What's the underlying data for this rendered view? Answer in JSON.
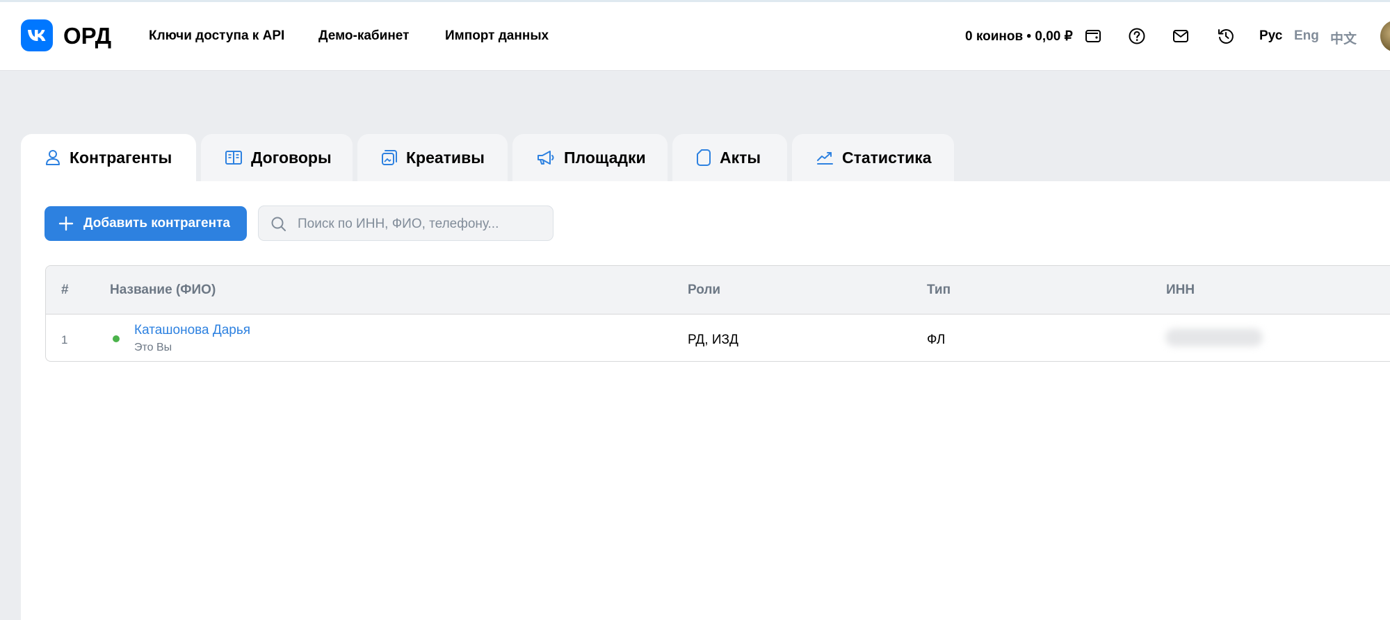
{
  "header": {
    "logo_text": "ОРД",
    "nav": [
      "Ключи доступа к API",
      "Демо-кабинет",
      "Импорт данных"
    ],
    "balance": "0 коинов • 0,00 ₽",
    "icons": [
      "wallet-icon",
      "help-icon",
      "mail-icon",
      "history-icon"
    ],
    "langs": {
      "ru": "Рус",
      "en": "Eng",
      "zh": "中文"
    }
  },
  "tabs": [
    {
      "label": "Контрагенты",
      "icon": "user-icon",
      "active": true
    },
    {
      "label": "Договоры",
      "icon": "book-icon",
      "active": false
    },
    {
      "label": "Креативы",
      "icon": "creative-icon",
      "active": false
    },
    {
      "label": "Площадки",
      "icon": "megaphone-icon",
      "active": false
    },
    {
      "label": "Акты",
      "icon": "document-icon",
      "active": false
    },
    {
      "label": "Статистика",
      "icon": "chart-icon",
      "active": false
    }
  ],
  "toolbar": {
    "add_label": "Добавить контрагента",
    "search_placeholder": "Поиск по ИНН, ФИО, телефону..."
  },
  "table": {
    "columns": [
      "#",
      "Название (ФИО)",
      "Роли",
      "Тип",
      "ИНН"
    ],
    "rows": [
      {
        "num": "1",
        "name": "Каташонова Дарья",
        "subtitle": "Это Вы",
        "roles": "РД, ИЗД",
        "type": "ФЛ",
        "status_color": "#4bb34b"
      }
    ]
  },
  "colors": {
    "accent": "#2d81e0",
    "brand": "#0077ff",
    "status_active": "#4bb34b"
  }
}
